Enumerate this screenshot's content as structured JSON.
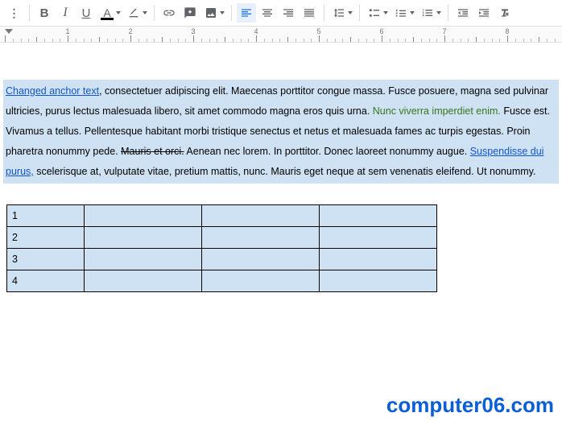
{
  "toolbar": {
    "btn_more": "⋮",
    "btn_bold": "B",
    "btn_italic": "I",
    "btn_underline": "U",
    "btn_textcolor": "A"
  },
  "paragraph": {
    "link1": "Changed anchor text",
    "seg1": ", consectetuer adipiscing elit. Maecenas porttitor congue massa. Fusce posuere, magna sed pulvinar ultricies, purus lectus malesuada libero, sit amet commodo magna eros quis urna. ",
    "green": "Nunc viverra imperdiet enim.",
    "seg2": " Fusce est. Vivamus a tellus. Pellentesque habitant morbi tristique senectus et netus et malesuada fames ac turpis egestas. Proin pharetra nonummy pede. ",
    "strike": "Mauris et orci.",
    "seg3": " Aenean nec lorem. In porttitor. Donec laoreet nonummy augue. ",
    "link2": "Suspendisse dui purus,",
    "seg4": " scelerisque at, vulputate vitae, pretium mattis, nunc. Mauris eget neque at sem venenatis eleifend. Ut nonummy."
  },
  "table": {
    "rows": [
      {
        "c0": "1",
        "c1": "",
        "c2": "",
        "c3": ""
      },
      {
        "c0": "2",
        "c1": "",
        "c2": "",
        "c3": ""
      },
      {
        "c0": "3",
        "c1": "",
        "c2": "",
        "c3": ""
      },
      {
        "c0": "4",
        "c1": "",
        "c2": "",
        "c3": ""
      }
    ]
  },
  "watermark": "computer06.com"
}
